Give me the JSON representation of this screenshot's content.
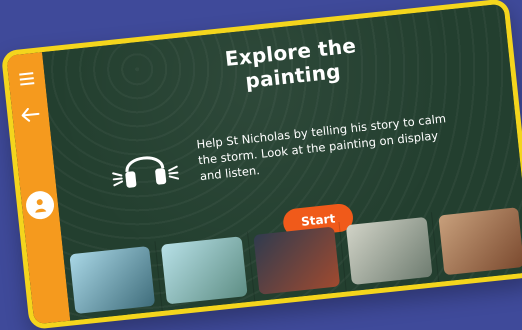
{
  "title": "Explore the painting",
  "description": "Help St Nicholas by telling his story to calm the storm. Look at the painting on display and listen.",
  "start_label": "Start",
  "icons": {
    "menu": "hamburger-icon",
    "back": "arrow-left-icon",
    "profile": "user-icon",
    "audio": "headphones-icon"
  },
  "colors": {
    "background": "#3f4a9a",
    "frame": "#f4d51d",
    "sidebar": "#f59a1e",
    "start_button": "#f05a1a"
  }
}
